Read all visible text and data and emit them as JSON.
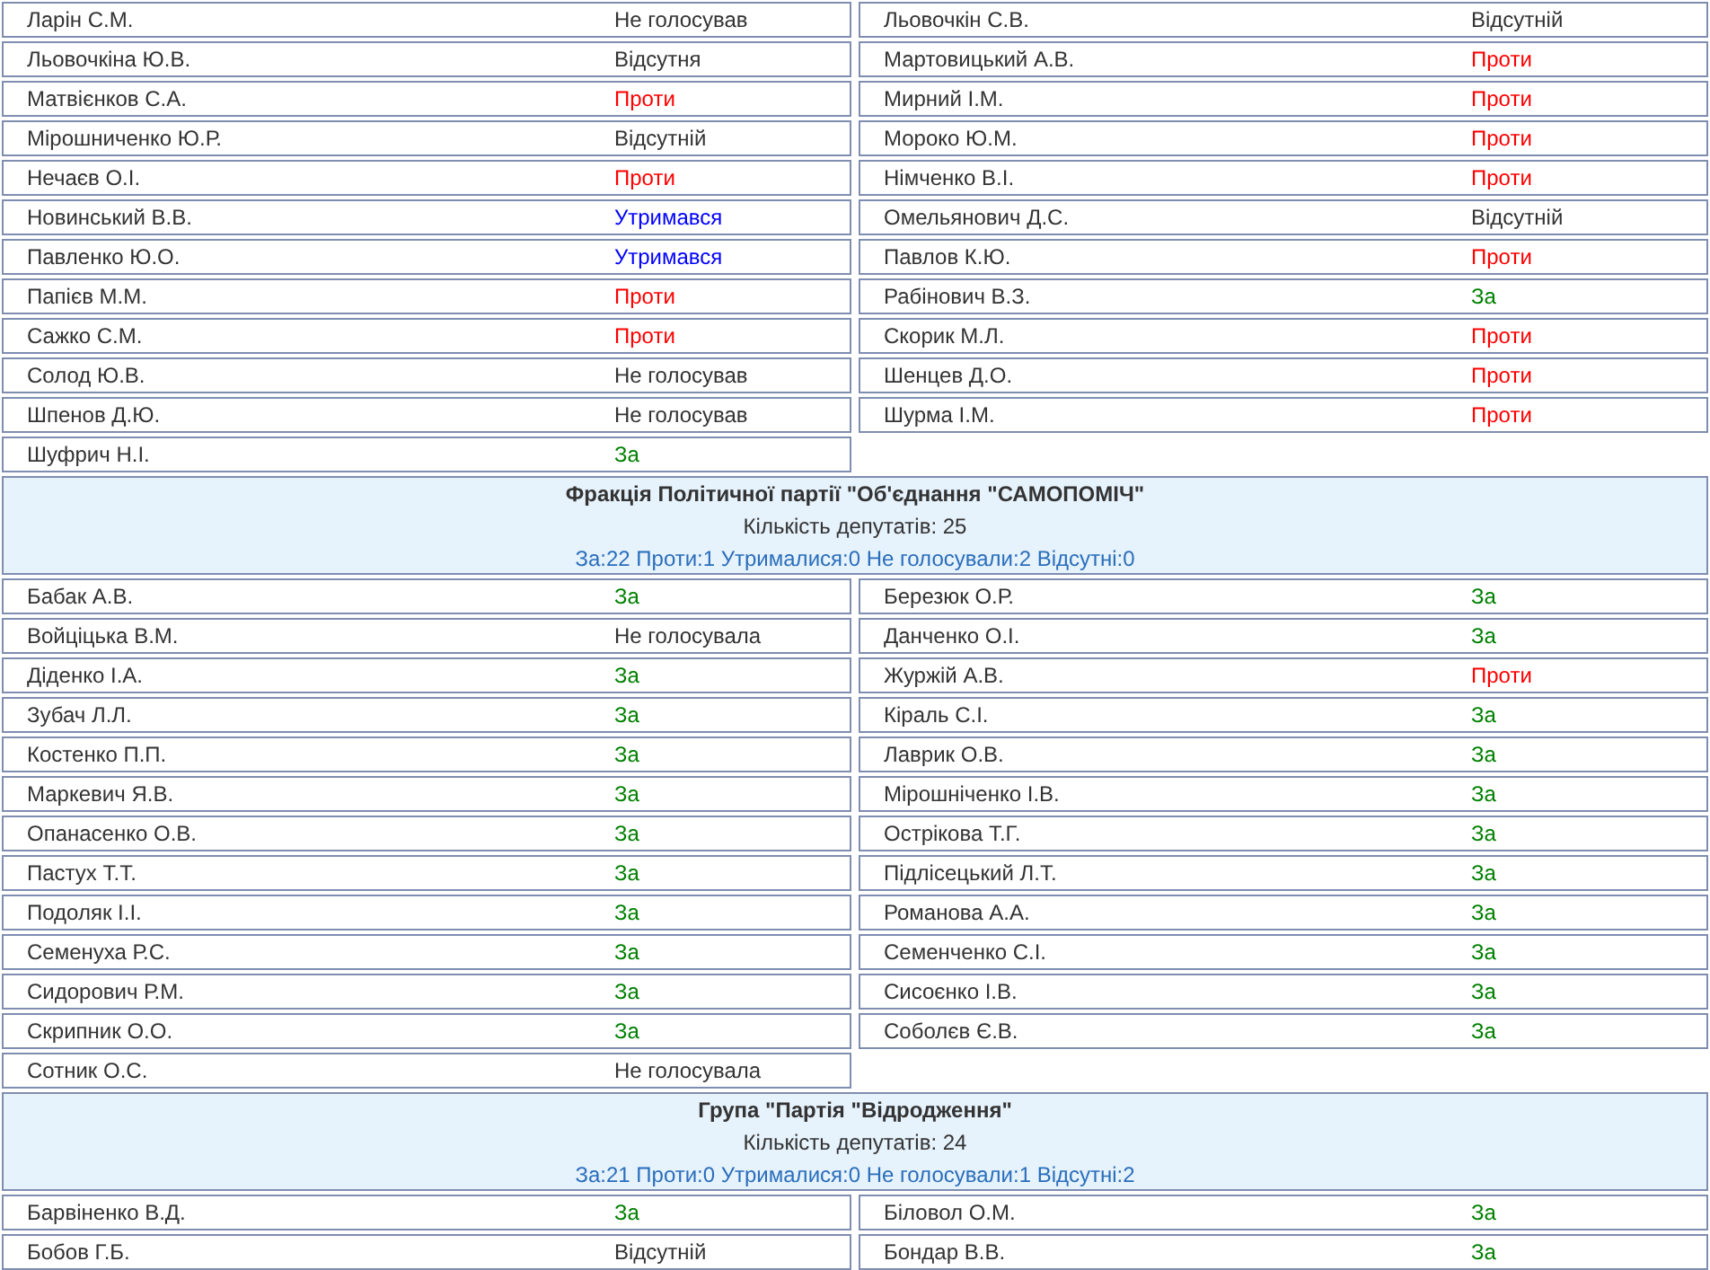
{
  "sections": [
    {
      "members": [
        {
          "name": "Ларін С.М.",
          "vote": {
            "text": "Не голосував",
            "kind": "none"
          }
        },
        {
          "name": "Льовочкін С.В.",
          "vote": {
            "text": "Відсутній",
            "kind": "none"
          }
        },
        {
          "name": "Льовочкіна Ю.В.",
          "vote": {
            "text": "Відсутня",
            "kind": "none"
          }
        },
        {
          "name": "Мартовицький А.В.",
          "vote": {
            "text": "Проти",
            "kind": "against"
          }
        },
        {
          "name": "Матвієнков С.А.",
          "vote": {
            "text": "Проти",
            "kind": "against"
          }
        },
        {
          "name": "Мирний І.М.",
          "vote": {
            "text": "Проти",
            "kind": "against"
          }
        },
        {
          "name": "Мірошниченко Ю.Р.",
          "vote": {
            "text": "Відсутній",
            "kind": "none"
          }
        },
        {
          "name": "Мороко Ю.М.",
          "vote": {
            "text": "Проти",
            "kind": "against"
          }
        },
        {
          "name": "Нечаєв О.І.",
          "vote": {
            "text": "Проти",
            "kind": "against"
          }
        },
        {
          "name": "Німченко В.І.",
          "vote": {
            "text": "Проти",
            "kind": "against"
          }
        },
        {
          "name": "Новинський В.В.",
          "vote": {
            "text": "Утримався",
            "kind": "abstain"
          }
        },
        {
          "name": "Омельянович Д.С.",
          "vote": {
            "text": "Відсутній",
            "kind": "none"
          }
        },
        {
          "name": "Павленко Ю.О.",
          "vote": {
            "text": "Утримався",
            "kind": "abstain"
          }
        },
        {
          "name": "Павлов К.Ю.",
          "vote": {
            "text": "Проти",
            "kind": "against"
          }
        },
        {
          "name": "Папієв М.М.",
          "vote": {
            "text": "Проти",
            "kind": "against"
          }
        },
        {
          "name": "Рабінович В.З.",
          "vote": {
            "text": "За",
            "kind": "for"
          }
        },
        {
          "name": "Сажко С.М.",
          "vote": {
            "text": "Проти",
            "kind": "against"
          }
        },
        {
          "name": "Скорик М.Л.",
          "vote": {
            "text": "Проти",
            "kind": "against"
          }
        },
        {
          "name": "Солод Ю.В.",
          "vote": {
            "text": "Не голосував",
            "kind": "none"
          }
        },
        {
          "name": "Шенцев Д.О.",
          "vote": {
            "text": "Проти",
            "kind": "against"
          }
        },
        {
          "name": "Шпенов Д.Ю.",
          "vote": {
            "text": "Не голосував",
            "kind": "none"
          }
        },
        {
          "name": "Шурма І.М.",
          "vote": {
            "text": "Проти",
            "kind": "against"
          }
        },
        {
          "name": "Шуфрич Н.І.",
          "vote": {
            "text": "За",
            "kind": "for"
          }
        }
      ]
    },
    {
      "header": {
        "title": "Фракція Політичної партії \"Об'єднання \"САМОПОМІЧ\"",
        "count": "Кількість депутатів: 25",
        "summary": "За:22 Проти:1 Утрималися:0 Не голосували:2 Відсутні:0"
      },
      "members": [
        {
          "name": "Бабак А.В.",
          "vote": {
            "text": "За",
            "kind": "for"
          }
        },
        {
          "name": "Березюк О.Р.",
          "vote": {
            "text": "За",
            "kind": "for"
          }
        },
        {
          "name": "Войціцька В.М.",
          "vote": {
            "text": "Не голосувала",
            "kind": "none"
          }
        },
        {
          "name": "Данченко О.І.",
          "vote": {
            "text": "За",
            "kind": "for"
          }
        },
        {
          "name": "Діденко І.А.",
          "vote": {
            "text": "За",
            "kind": "for"
          }
        },
        {
          "name": "Журжій А.В.",
          "vote": {
            "text": "Проти",
            "kind": "against"
          }
        },
        {
          "name": "Зубач Л.Л.",
          "vote": {
            "text": "За",
            "kind": "for"
          }
        },
        {
          "name": "Кіраль С.І.",
          "vote": {
            "text": "За",
            "kind": "for"
          }
        },
        {
          "name": "Костенко П.П.",
          "vote": {
            "text": "За",
            "kind": "for"
          }
        },
        {
          "name": "Лаврик О.В.",
          "vote": {
            "text": "За",
            "kind": "for"
          }
        },
        {
          "name": "Маркевич Я.В.",
          "vote": {
            "text": "За",
            "kind": "for"
          }
        },
        {
          "name": "Мірошніченко І.В.",
          "vote": {
            "text": "За",
            "kind": "for"
          }
        },
        {
          "name": "Опанасенко О.В.",
          "vote": {
            "text": "За",
            "kind": "for"
          }
        },
        {
          "name": "Острікова Т.Г.",
          "vote": {
            "text": "За",
            "kind": "for"
          }
        },
        {
          "name": "Пастух Т.Т.",
          "vote": {
            "text": "За",
            "kind": "for"
          }
        },
        {
          "name": "Підлісецький Л.Т.",
          "vote": {
            "text": "За",
            "kind": "for"
          }
        },
        {
          "name": "Подоляк І.І.",
          "vote": {
            "text": "За",
            "kind": "for"
          }
        },
        {
          "name": "Романова А.А.",
          "vote": {
            "text": "За",
            "kind": "for"
          }
        },
        {
          "name": "Семенуха Р.С.",
          "vote": {
            "text": "За",
            "kind": "for"
          }
        },
        {
          "name": "Семенченко С.І.",
          "vote": {
            "text": "За",
            "kind": "for"
          }
        },
        {
          "name": "Сидорович Р.М.",
          "vote": {
            "text": "За",
            "kind": "for"
          }
        },
        {
          "name": "Сисоєнко І.В.",
          "vote": {
            "text": "За",
            "kind": "for"
          }
        },
        {
          "name": "Скрипник О.О.",
          "vote": {
            "text": "За",
            "kind": "for"
          }
        },
        {
          "name": "Соболєв Є.В.",
          "vote": {
            "text": "За",
            "kind": "for"
          }
        },
        {
          "name": "Сотник О.С.",
          "vote": {
            "text": "Не голосувала",
            "kind": "none"
          }
        }
      ]
    },
    {
      "header": {
        "title": "Група \"Партія \"Відродження\"",
        "count": "Кількість депутатів: 24",
        "summary": "За:21 Проти:0 Утрималися:0 Не голосували:1 Відсутні:2"
      },
      "members": [
        {
          "name": "Барвіненко В.Д.",
          "vote": {
            "text": "За",
            "kind": "for"
          }
        },
        {
          "name": "Біловол О.М.",
          "vote": {
            "text": "За",
            "kind": "for"
          }
        },
        {
          "name": "Бобов Г.Б.",
          "vote": {
            "text": "Відсутній",
            "kind": "none"
          }
        },
        {
          "name": "Бондар В.В.",
          "vote": {
            "text": "За",
            "kind": "for"
          }
        }
      ]
    }
  ]
}
